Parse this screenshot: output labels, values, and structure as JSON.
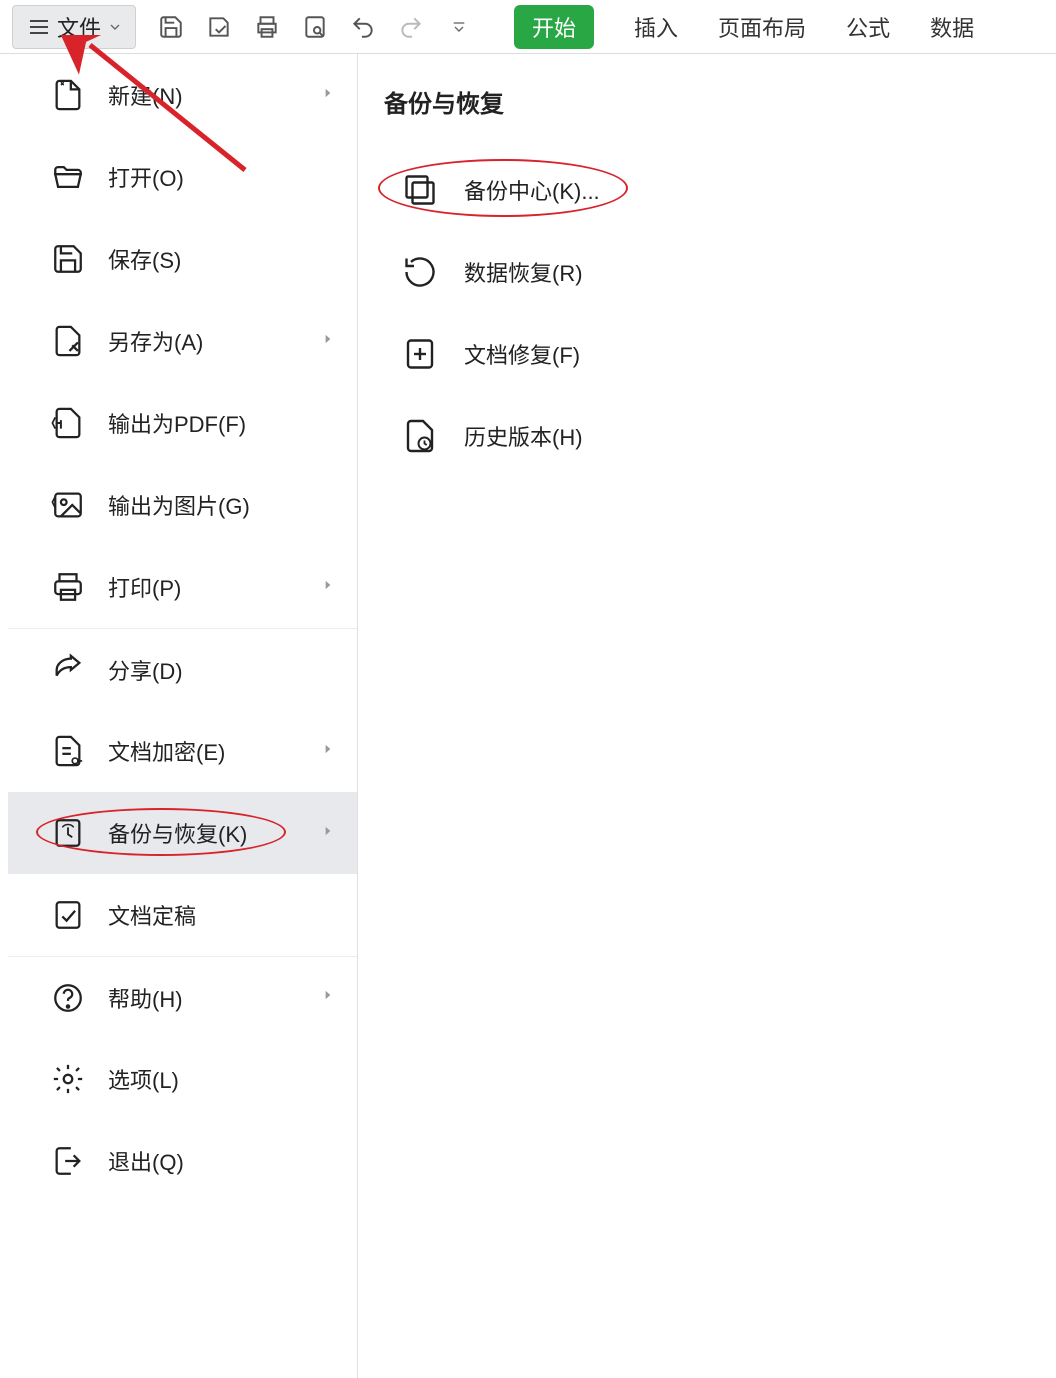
{
  "toolbar": {
    "file_label": "文件",
    "tabs": {
      "start": "开始",
      "insert": "插入",
      "layout": "页面布局",
      "formula": "公式",
      "data": "数据"
    }
  },
  "menu": {
    "items": [
      {
        "id": "new",
        "label": "新建(N)",
        "chevron": true
      },
      {
        "id": "open",
        "label": "打开(O)",
        "chevron": false
      },
      {
        "id": "save",
        "label": "保存(S)",
        "chevron": false
      },
      {
        "id": "saveas",
        "label": "另存为(A)",
        "chevron": true
      },
      {
        "id": "pdf",
        "label": "输出为PDF(F)",
        "chevron": false
      },
      {
        "id": "image",
        "label": "输出为图片(G)",
        "chevron": false
      },
      {
        "id": "print",
        "label": "打印(P)",
        "chevron": true
      },
      {
        "id": "share",
        "label": "分享(D)",
        "chevron": false
      },
      {
        "id": "encrypt",
        "label": "文档加密(E)",
        "chevron": true
      },
      {
        "id": "backup",
        "label": "备份与恢复(K)",
        "chevron": true
      },
      {
        "id": "finalize",
        "label": "文档定稿",
        "chevron": false
      },
      {
        "id": "help",
        "label": "帮助(H)",
        "chevron": true
      },
      {
        "id": "options",
        "label": "选项(L)",
        "chevron": false
      },
      {
        "id": "exit",
        "label": "退出(Q)",
        "chevron": false
      }
    ]
  },
  "submenu": {
    "title": "备份与恢复",
    "items": [
      {
        "id": "backup-center",
        "label": "备份中心(K)..."
      },
      {
        "id": "data-recover",
        "label": "数据恢复(R)"
      },
      {
        "id": "doc-repair",
        "label": "文档修复(F)"
      },
      {
        "id": "history",
        "label": "历史版本(H)"
      }
    ]
  }
}
